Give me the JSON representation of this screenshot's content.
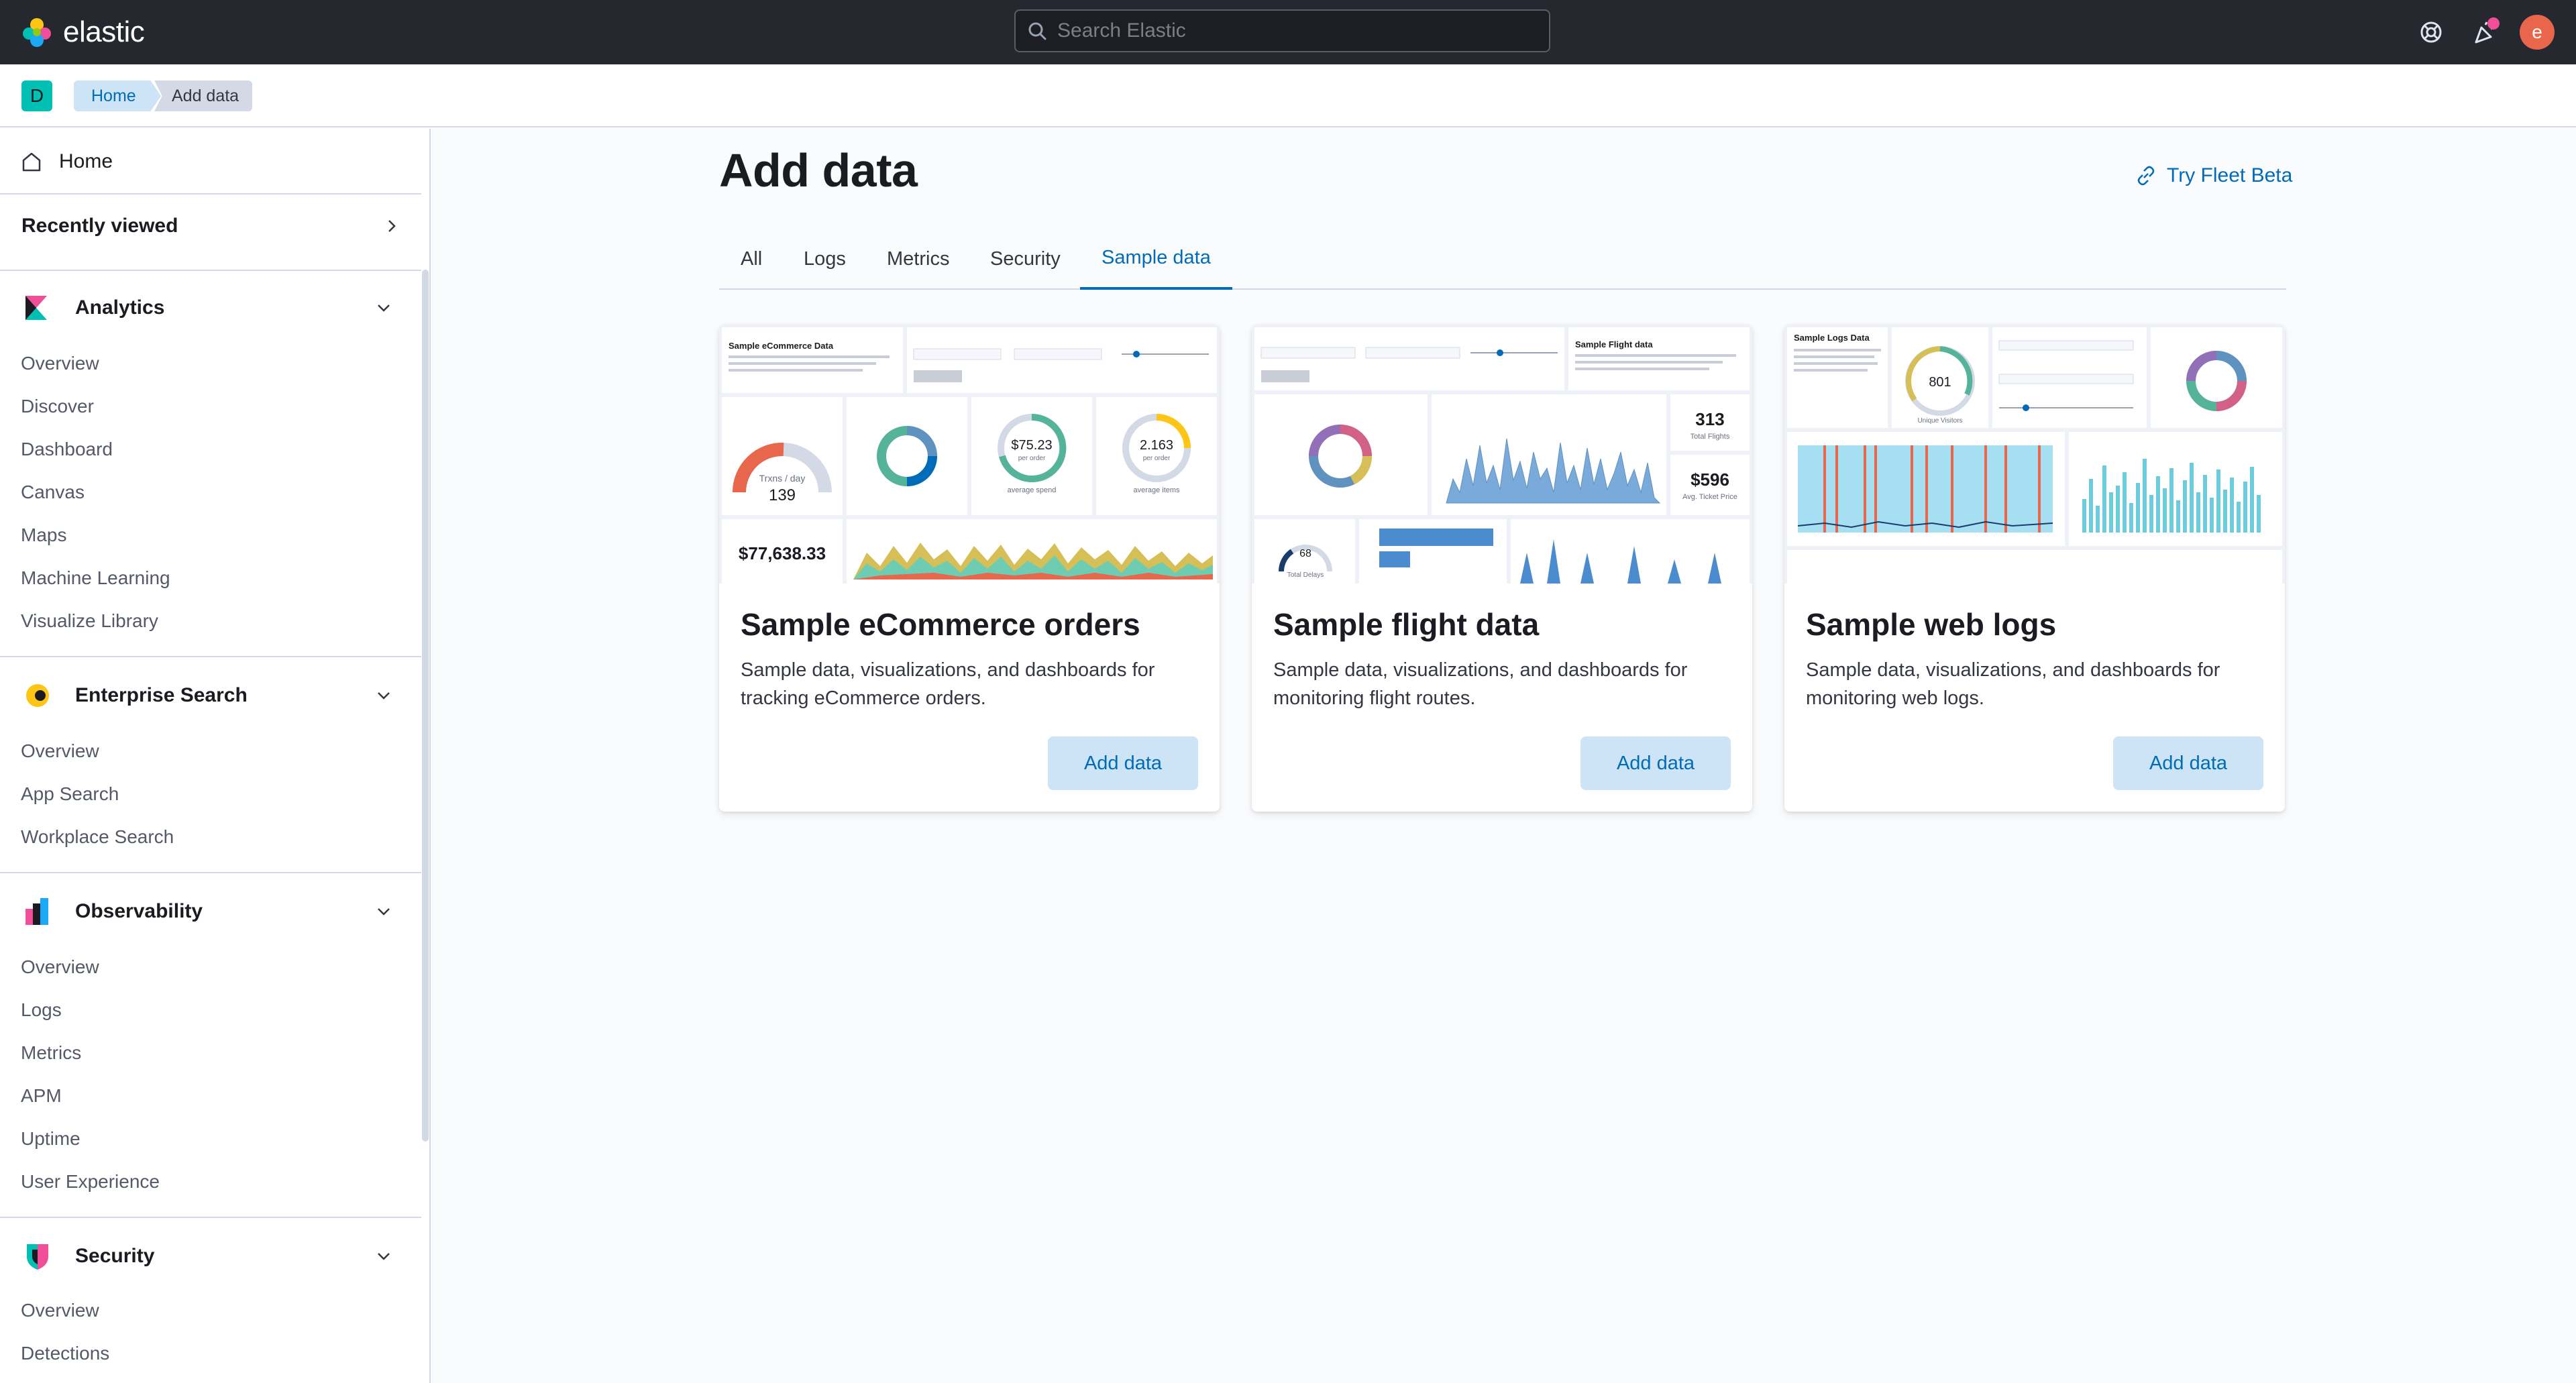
{
  "header": {
    "app_name": "elastic",
    "search_placeholder": "Search Elastic",
    "avatar_letter": "e"
  },
  "breadcrumb": {
    "space_letter": "D",
    "items": [
      "Home",
      "Add data"
    ]
  },
  "sidebar": {
    "home_label": "Home",
    "recently_viewed_label": "Recently viewed",
    "groups": [
      {
        "title": "Analytics",
        "items": [
          "Overview",
          "Discover",
          "Dashboard",
          "Canvas",
          "Maps",
          "Machine Learning",
          "Visualize Library"
        ]
      },
      {
        "title": "Enterprise Search",
        "items": [
          "Overview",
          "App Search",
          "Workplace Search"
        ]
      },
      {
        "title": "Observability",
        "items": [
          "Overview",
          "Logs",
          "Metrics",
          "APM",
          "Uptime",
          "User Experience"
        ]
      },
      {
        "title": "Security",
        "items": [
          "Overview",
          "Detections"
        ]
      }
    ]
  },
  "main": {
    "title": "Add data",
    "fleet_link": "Try Fleet Beta",
    "tabs": [
      "All",
      "Logs",
      "Metrics",
      "Security",
      "Sample data"
    ],
    "active_tab": "Sample data",
    "cards": [
      {
        "title": "Sample eCommerce orders",
        "description": "Sample data, visualizations, and dashboards for tracking eCommerce orders.",
        "button": "Add data",
        "preview": {
          "header": "Sample eCommerce Data",
          "gauge_label": "Trxns / day",
          "gauge_value": "139",
          "avg_spend": "$75.23",
          "avg_spend_sub": "per order",
          "avg_spend_label": "average spend",
          "avg_items": "2.163",
          "avg_items_sub": "per order",
          "avg_items_label": "average items",
          "total_revenue": "$77,638.33"
        }
      },
      {
        "title": "Sample flight data",
        "description": "Sample data, visualizations, and dashboards for monitoring flight routes.",
        "button": "Add data",
        "preview": {
          "header": "Sample Flight data",
          "total_flights": "313",
          "total_flights_label": "Total Flights",
          "avg_price": "$596",
          "avg_price_label": "Avg. Ticket Price",
          "delays": "68",
          "delays_label": "Total Delays"
        }
      },
      {
        "title": "Sample web logs",
        "description": "Sample data, visualizations, and dashboards for monitoring web logs.",
        "button": "Add data",
        "preview": {
          "header": "Sample Logs Data",
          "visitors": "801",
          "visitors_label": "Unique Visitors"
        }
      }
    ]
  },
  "colors": {
    "header_bg": "#25282f",
    "accent": "#006bb8",
    "accent_light": "#cce4f5",
    "avatar": "#e7664c",
    "space_badge": "#00bfb3",
    "notification_dot": "#f04e98"
  }
}
